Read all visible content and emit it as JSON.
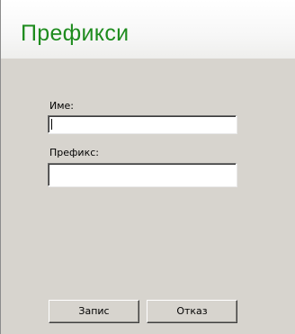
{
  "header": {
    "title": "Префикси"
  },
  "form": {
    "name_label": "Име:",
    "name_value": "",
    "prefix_label": "Префикс:",
    "prefix_value": ""
  },
  "buttons": {
    "save_label": "Запис",
    "cancel_label": "Отказ"
  },
  "colors": {
    "title": "#1e8c1e",
    "panel_background": "#d7d4ce",
    "header_background": "#ffffff"
  }
}
